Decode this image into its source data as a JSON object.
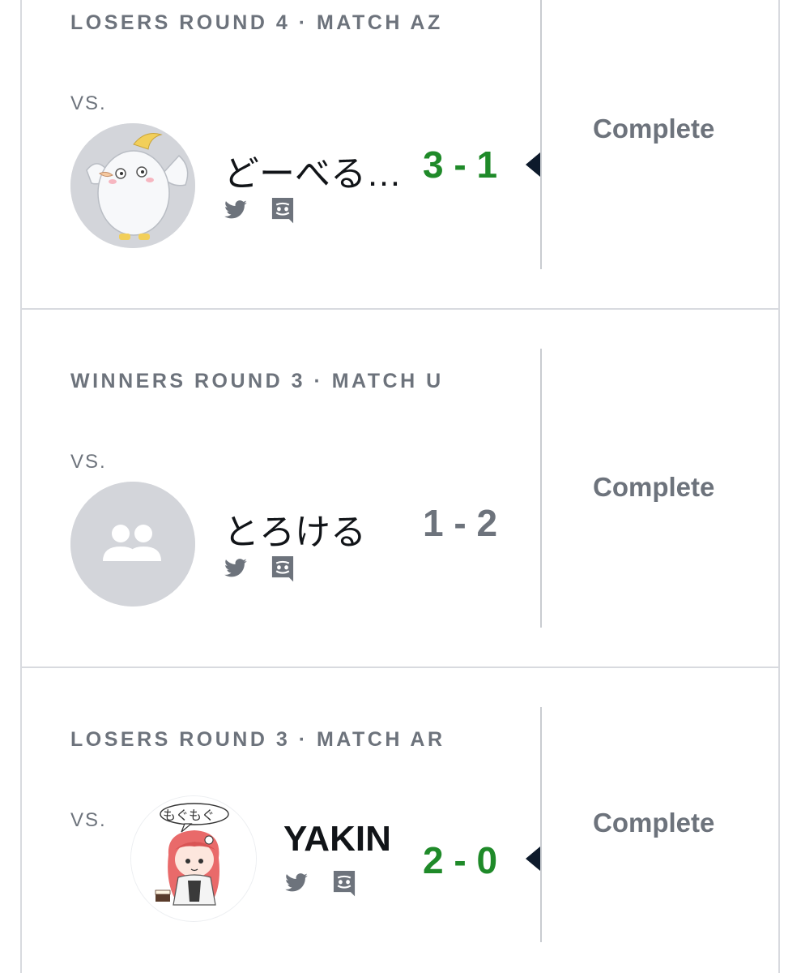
{
  "colors": {
    "win_score": "#1f8a29",
    "neutral_score": "#6d737c",
    "muted_text": "#6d737c",
    "divider": "#d8dadf"
  },
  "matches": [
    {
      "title": "LOSERS ROUND 4 · MATCH AZ",
      "vs_label": "VS.",
      "opponent_name": "どーべる…",
      "score": "3 - 1",
      "score_state": "win",
      "status": "Complete",
      "avatar": "white-bird-character",
      "social_icons": [
        "twitter-icon",
        "discord-icon"
      ]
    },
    {
      "title": "WINNERS ROUND 3 · MATCH U",
      "vs_label": "VS.",
      "opponent_name": "とろける",
      "score": "1 - 2",
      "score_state": "loss",
      "status": "Complete",
      "avatar": "default-team-avatar",
      "social_icons": [
        "twitter-icon",
        "discord-icon"
      ]
    },
    {
      "title": "LOSERS ROUND 3 · MATCH AR",
      "vs_label": "VS.",
      "opponent_name": "YAKIN",
      "score": "2 - 0",
      "score_state": "win",
      "status": "Complete",
      "avatar": "anime-girl-character",
      "avatar_bubble_text": "もぐもぐ",
      "social_icons": [
        "twitter-icon",
        "discord-icon"
      ]
    }
  ]
}
